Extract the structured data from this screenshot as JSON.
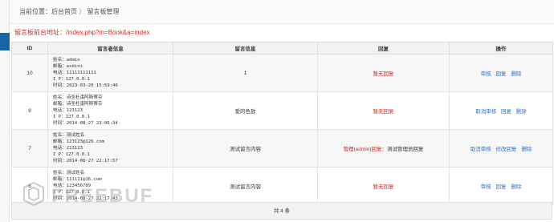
{
  "breadcrumb": {
    "prefix": "当前位置：",
    "home": "后台首页",
    "separator": "〉",
    "current": "留言板管理"
  },
  "frontend_address": "留言板前台地址：/index.php?m=Book&a=index",
  "table": {
    "headers": {
      "id": "ID",
      "author": "留言者信息",
      "message": "留言信息",
      "reply": "回复",
      "actions": "操作"
    },
    "rows": [
      {
        "id": "10",
        "name": "姓名：admin",
        "email": "邮箱：asdini",
        "phone": "电话：11111111111",
        "ip": "I P：127.0.0.1",
        "time": "时间：2023-03-20 15:59:40",
        "message": "1",
        "reply_prefix": "",
        "reply_main": "暂无回复",
        "actions": [
          "审核",
          "回复",
          "删除"
        ]
      },
      {
        "id": "9",
        "name": "姓名：诗圣杜甫阿斯蒂芬",
        "email": "邮箱：诗圣杜甫阿斯蒂芬",
        "phone": "电话：123123",
        "ip": "I P：127.0.0.1",
        "time": "时间：2014-08-27 23:06:34",
        "message": "爱的色放",
        "reply_prefix": "",
        "reply_main": "暂无回复",
        "actions": [
          "取消审核",
          "回复",
          "删除"
        ]
      },
      {
        "id": "7",
        "name": "姓名：测试姓名",
        "email": "邮箱：123123@126.com",
        "phone": "电话：213123",
        "ip": "I P：127.0.0.1",
        "time": "时间：2014-08-27 22:17:57",
        "message": "测试留言内容",
        "reply_prefix": "管理(admin)回复：",
        "reply_main": "测试管理员回复",
        "actions": [
          "取消审核",
          "修改回复",
          "删除"
        ]
      },
      {
        "id": "6",
        "name": "姓名：测试姓名",
        "email": "邮箱：111111@16.com",
        "phone": "电话：123456789",
        "ip": "I P：127.0.0.1",
        "time": "时间：2014-08-27 22:17:43",
        "message": "测试留言内容",
        "reply_prefix": "",
        "reply_main": "暂无回复",
        "actions": [
          "审核",
          "回复",
          "删除"
        ]
      }
    ]
  },
  "pagination": "共 4 条",
  "watermark": "FREEBUF",
  "colors": {
    "accent": "#1a63a8",
    "alert": "#e02020",
    "link": "#2f6fc4"
  }
}
